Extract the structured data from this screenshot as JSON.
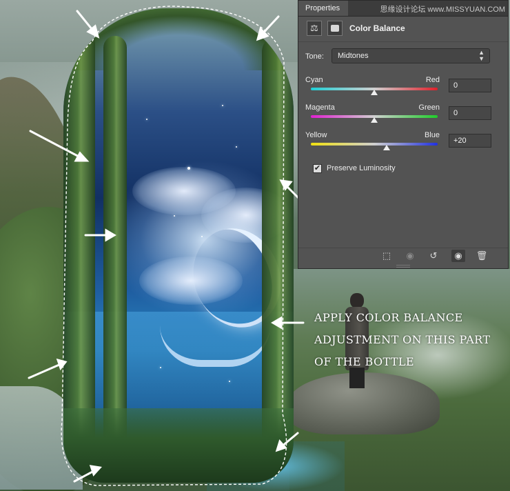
{
  "properties_panel": {
    "tab_label": "Properties",
    "watermark": "思缘设计论坛 www.MISSYUAN.COM",
    "adjustment_title": "Color Balance",
    "header_icons": [
      "balance-scale-icon",
      "mask-icon"
    ],
    "tone": {
      "label": "Tone:",
      "value": "Midtones"
    },
    "sliders": [
      {
        "left_label": "Cyan",
        "right_label": "Red",
        "value": "0",
        "position": 0.5
      },
      {
        "left_label": "Magenta",
        "right_label": "Green",
        "value": "0",
        "position": 0.5
      },
      {
        "left_label": "Yellow",
        "right_label": "Blue",
        "value": "+20",
        "position": 0.6
      }
    ],
    "preserve_luminosity": {
      "label": "Preserve Luminosity",
      "checked": true
    },
    "footer_buttons": [
      "clip-to-layer-icon",
      "view-previous-state-icon",
      "reset-icon",
      "visibility-eye-icon",
      "trash-icon"
    ]
  },
  "annotation": {
    "lines": [
      "APPLY COLOR BALANCE",
      "ADJUSTMENT ON THIS PART",
      "OF THE BOTTLE"
    ]
  },
  "colors": {
    "panel_bg": "#535353",
    "annotation_text": "#ffffff",
    "arrow_color": "#ffffff"
  }
}
